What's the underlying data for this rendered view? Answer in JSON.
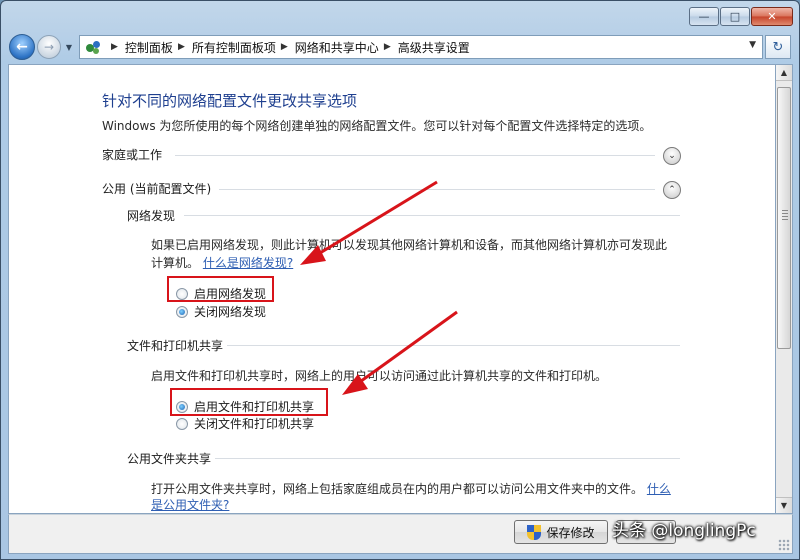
{
  "window": {
    "minimize": "—",
    "maximize": "□",
    "close": "✕"
  },
  "nav": {
    "back": "←",
    "forward": "→",
    "history_dropdown": "▼",
    "refresh": "↻"
  },
  "breadcrumb": {
    "items": [
      "控制面板",
      "所有控制面板项",
      "网络和共享中心",
      "高级共享设置"
    ],
    "separator": "▶",
    "dropdown": "▼"
  },
  "page": {
    "title": "针对不同的网络配置文件更改共享选项",
    "description": "Windows 为您所使用的每个网络创建单独的网络配置文件。您可以针对每个配置文件选择特定的选项。"
  },
  "profiles": {
    "home_work": {
      "label": "家庭或工作",
      "toggle": "⌄"
    },
    "public": {
      "label": "公用 (当前配置文件)",
      "toggle": "⌃"
    }
  },
  "network_discovery": {
    "heading": "网络发现",
    "text_line1": "如果已启用网络发现，则此计算机可以发现其他网络计算机和设备，而其他网络计算机亦可发现此",
    "text_line2": "计算机。",
    "link": "什么是网络发现?",
    "option_on": "启用网络发现",
    "option_off": "关闭网络发现",
    "selected": "off"
  },
  "file_printer_sharing": {
    "heading": "文件和打印机共享",
    "text": "启用文件和打印机共享时，网络上的用户可以访问通过此计算机共享的文件和打印机。",
    "option_on": "启用文件和打印机共享",
    "option_off": "关闭文件和打印机共享",
    "selected": "on"
  },
  "public_folder_sharing": {
    "heading": "公用文件夹共享",
    "text": "打开公用文件夹共享时，网络上包括家庭组成员在内的用户都可以访问公用文件夹中的文件。",
    "link_part1": "什么",
    "link_part2": "是公用文件夹?"
  },
  "buttons": {
    "save": "保存修改",
    "cancel": ""
  },
  "scrollbar": {
    "up": "▲",
    "down": "▼"
  },
  "watermark": "头条 @longlingPc",
  "colors": {
    "highlight": "#d8141a",
    "title": "#1e3f8f",
    "link": "#2f5fb3"
  }
}
